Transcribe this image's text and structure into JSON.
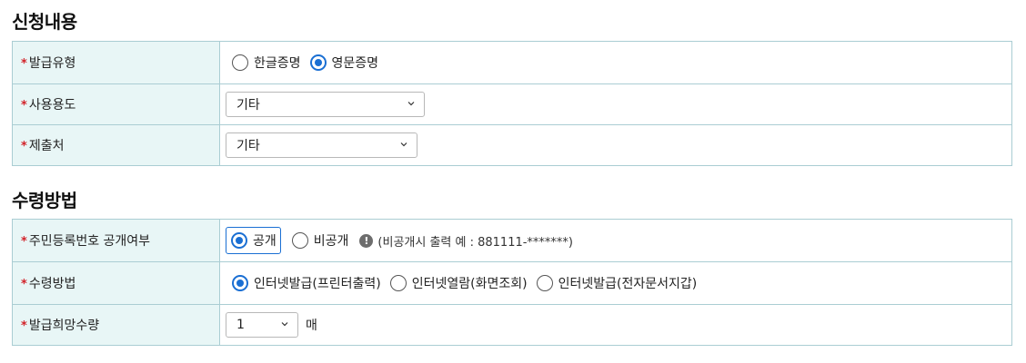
{
  "section1": {
    "title": "신청내용",
    "rows": {
      "issue_type": {
        "label": "발급유형",
        "options": [
          "한글증명",
          "영문증명"
        ],
        "selected": "영문증명"
      },
      "usage": {
        "label": "사용용도",
        "value": "기타"
      },
      "submit_to": {
        "label": "제출처",
        "value": "기타"
      }
    }
  },
  "section2": {
    "title": "수령방법",
    "rows": {
      "rrn_disclosure": {
        "label": "주민등록번호 공개여부",
        "options": [
          "공개",
          "비공개"
        ],
        "selected": "공개",
        "note": "(비공개시 출력 예 : 881111-*******)"
      },
      "receive_method": {
        "label": "수령방법",
        "options": [
          "인터넷발급(프린터출력)",
          "인터넷열람(화면조회)",
          "인터넷발급(전자문서지갑)"
        ],
        "selected": "인터넷발급(프린터출력)"
      },
      "quantity": {
        "label": "발급희망수량",
        "value": "1",
        "unit": "매"
      }
    }
  },
  "required_mark": "*",
  "colors": {
    "accent": "#1a6fd3",
    "label_bg": "#e8f6f6",
    "border": "#aacdd3",
    "required": "#d2232a"
  }
}
